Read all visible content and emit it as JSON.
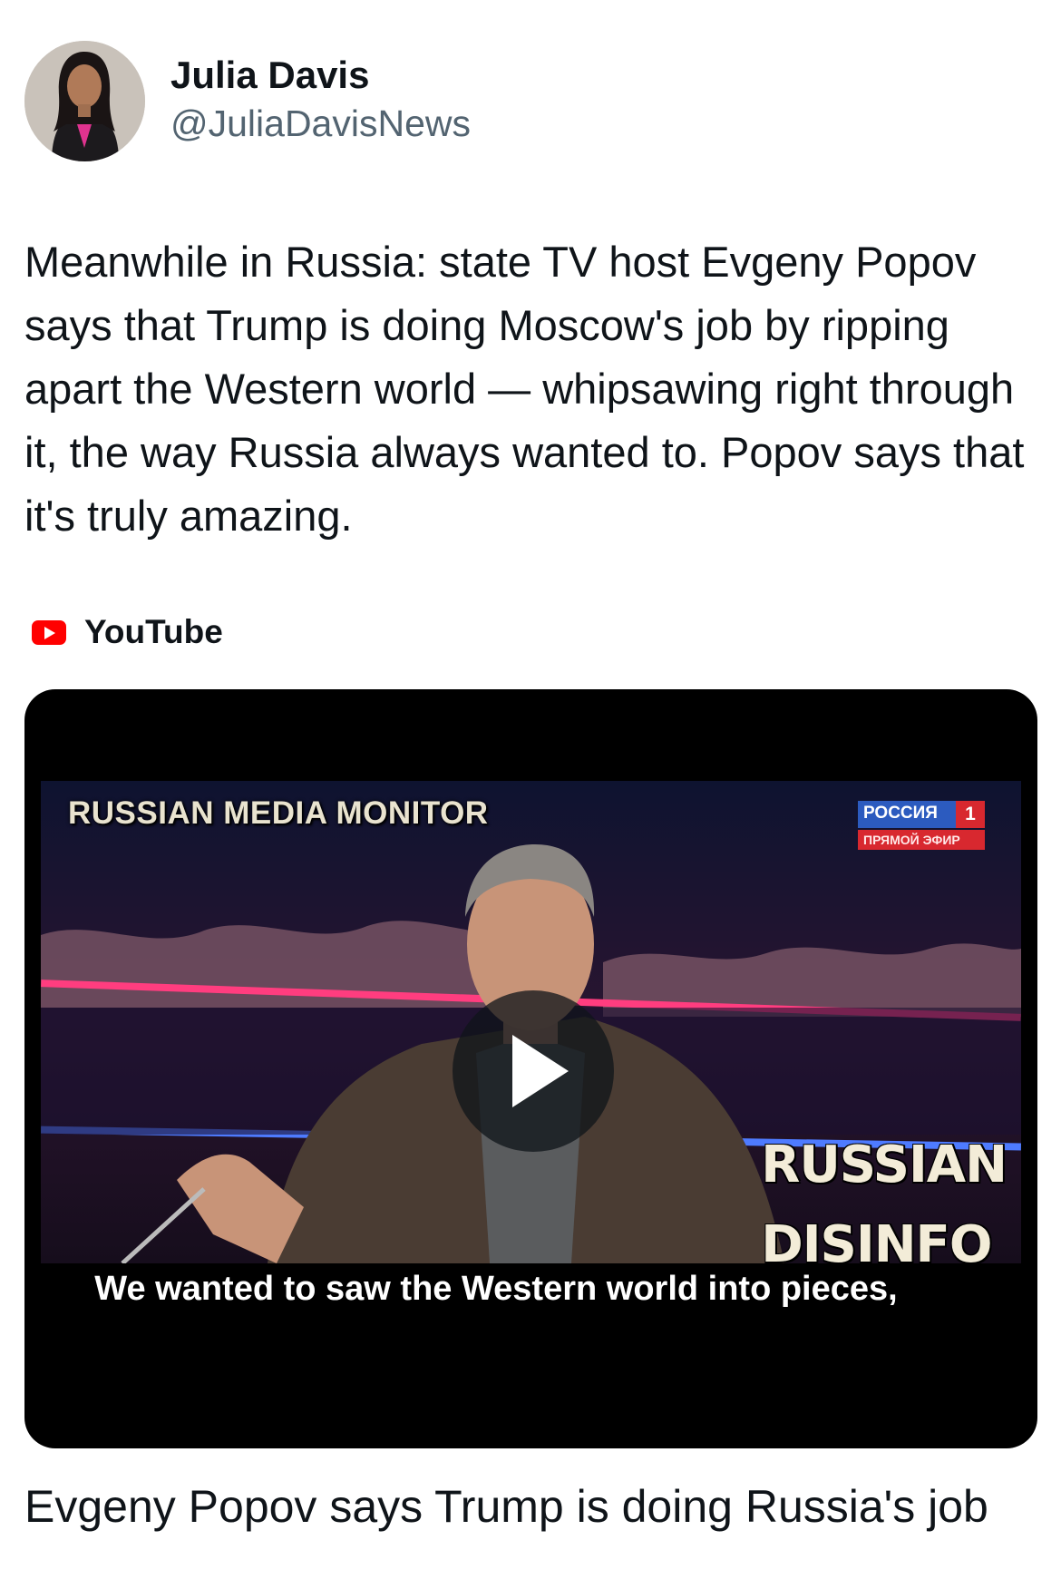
{
  "author": {
    "display_name": "Julia Davis",
    "handle": "@JuliaDavisNews",
    "avatar_icon": "profile-photo"
  },
  "tweet": {
    "text": "Meanwhile in Russia: state TV host Evgeny Popov says that Trump is doing Moscow's job by ripping apart the Western world — whipsawing right through it, the way Russia always wanted to. Popov says that it's truly amazing."
  },
  "link_card": {
    "source_icon": "youtube-icon",
    "source": "YouTube",
    "video": {
      "watermark": "RUSSIAN MEDIA MONITOR",
      "channel_name": "РОССИЯ",
      "channel_number": "1",
      "channel_live": "ПРЯМОЙ ЭФИР",
      "overlay_line1": "RUSSIAN",
      "overlay_line2": "DISINFO",
      "subtitle": "We wanted to saw the Western world into pieces,",
      "play_icon": "play-icon"
    },
    "title": "Evgeny Popov says Trump is doing Russia's job"
  },
  "colors": {
    "text_primary": "#0f1419",
    "text_secondary": "#536471",
    "youtube_red": "#ff0000"
  }
}
